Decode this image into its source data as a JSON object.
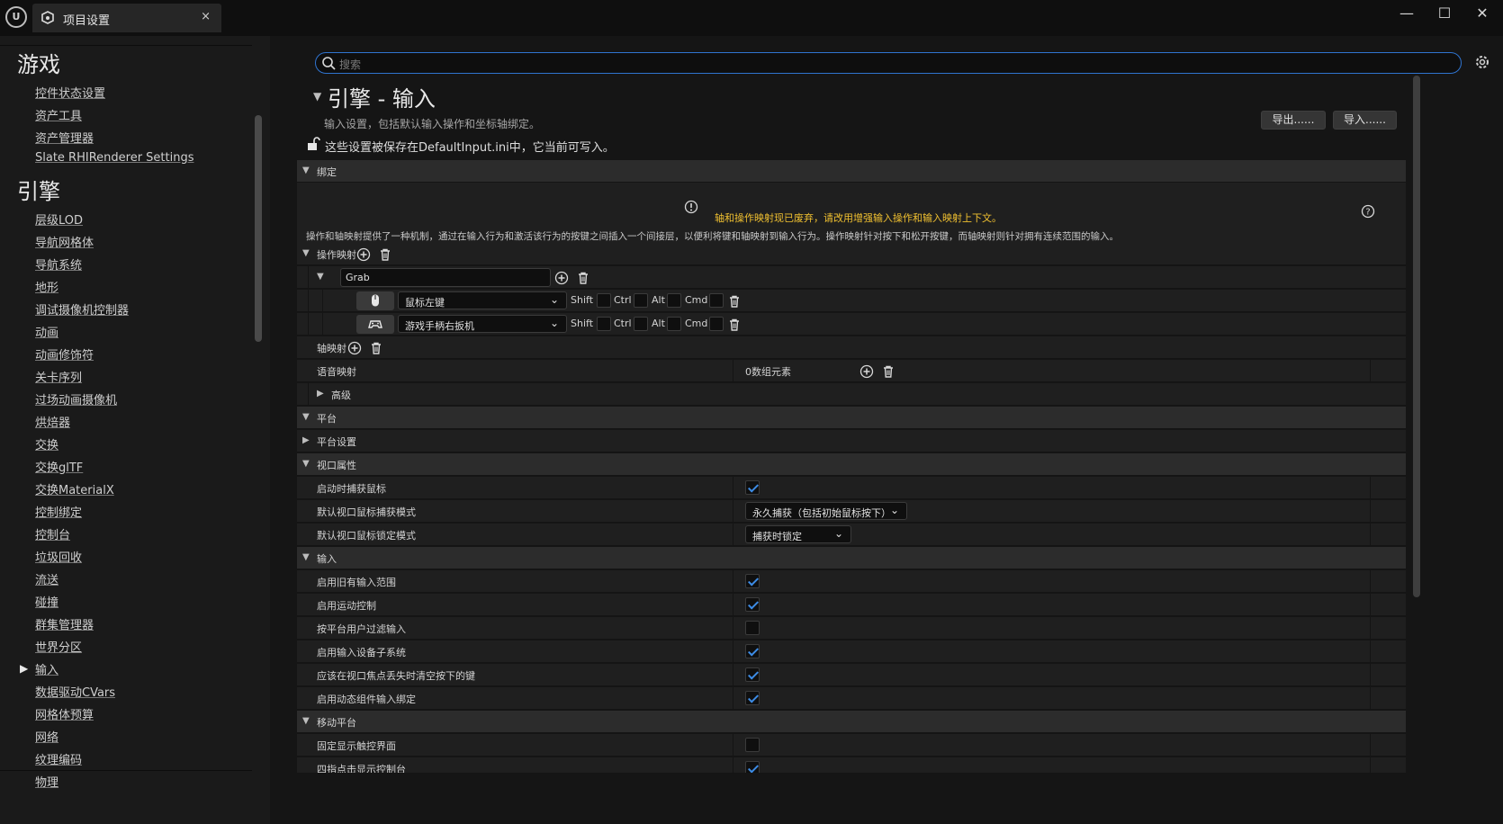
{
  "window": {
    "tab_title": "项目设置",
    "close_glyph": "×",
    "minimize_glyph": "—",
    "maximize_glyph": "☐",
    "window_close_glyph": "✕"
  },
  "sidebar": {
    "categories": [
      "游戏",
      "引擎"
    ],
    "game_items": [
      "控件状态设置",
      "资产工具",
      "资产管理器",
      "Slate RHIRenderer Settings"
    ],
    "engine_items": [
      "层级LOD",
      "导航网格体",
      "导航系统",
      "地形",
      "调试摄像机控制器",
      "动画",
      "动画修饰符",
      "关卡序列",
      "过场动画摄像机",
      "烘焙器",
      "交换",
      "交换glTF",
      "交换MaterialX",
      "控制绑定",
      "控制台",
      "垃圾回收",
      "流送",
      "碰撞",
      "群集管理器",
      "世界分区",
      "输入",
      "数据驱动CVars",
      "网格体预算",
      "网络",
      "纹理编码",
      "物理"
    ],
    "selected_item": "输入"
  },
  "search": {
    "placeholder": "搜索"
  },
  "header": {
    "title": "引擎 - 输入",
    "description": "输入设置，包括默认输入操作和坐标轴绑定。",
    "export_label": "导出......",
    "import_label": "导入......",
    "save_note": "这些设置被保存在DefaultInput.ini中，它当前可写入。"
  },
  "bindings": {
    "section": "绑定",
    "warning": "轴和操作映射现已废弃，请改用增强输入操作和输入映射上下文。",
    "description": "操作和轴映射提供了一种机制，通过在输入行为和激活该行为的按键之间插入一个间接层，以便利将键和轴映射到输入行为。操作映射针对按下和松开按键，而轴映射则针对拥有连续范围的输入。",
    "action_mappings_label": "操作映射",
    "action_name": "Grab",
    "keys": [
      {
        "icon": "mouse-icon",
        "key": "鼠标左键",
        "shift": false,
        "ctrl": false,
        "alt": false,
        "cmd": false
      },
      {
        "icon": "gamepad-icon",
        "key": "游戏手柄右扳机",
        "shift": false,
        "ctrl": false,
        "alt": false,
        "cmd": false
      }
    ],
    "modifiers": [
      "Shift",
      "Ctrl",
      "Alt",
      "Cmd"
    ],
    "axis_mappings_label": "轴映射",
    "speech_mappings_label": "语音映射",
    "speech_mappings_value": "0数组元素",
    "advanced_label": "高级"
  },
  "platform": {
    "section": "平台",
    "settings_label": "平台设置"
  },
  "viewport": {
    "section": "视口属性",
    "rows": [
      {
        "label": "启动时捕获鼠标",
        "type": "checkbox",
        "checked": true
      },
      {
        "label": "默认视口鼠标捕获模式",
        "type": "dropdown",
        "value": "永久捕获（包括初始鼠标按下）"
      },
      {
        "label": "默认视口鼠标锁定模式",
        "type": "dropdown",
        "value": "捕获时锁定"
      }
    ]
  },
  "input": {
    "section": "输入",
    "rows": [
      {
        "label": "启用旧有输入范围",
        "checked": true
      },
      {
        "label": "启用运动控制",
        "checked": true
      },
      {
        "label": "按平台用户过滤输入",
        "checked": false
      },
      {
        "label": "启用输入设备子系统",
        "checked": true
      },
      {
        "label": "应该在视口焦点丢失时清空按下的键",
        "checked": true
      },
      {
        "label": "启用动态组件输入绑定",
        "checked": true
      }
    ]
  },
  "mobile": {
    "section": "移动平台",
    "rows": [
      {
        "label": "固定显示触控界面",
        "checked": false
      },
      {
        "label": "四指点击显示控制台",
        "checked": true
      }
    ]
  },
  "colors": {
    "accent": "#2f74d0",
    "check": "#3d8ce6",
    "warning": "#f0c030"
  }
}
